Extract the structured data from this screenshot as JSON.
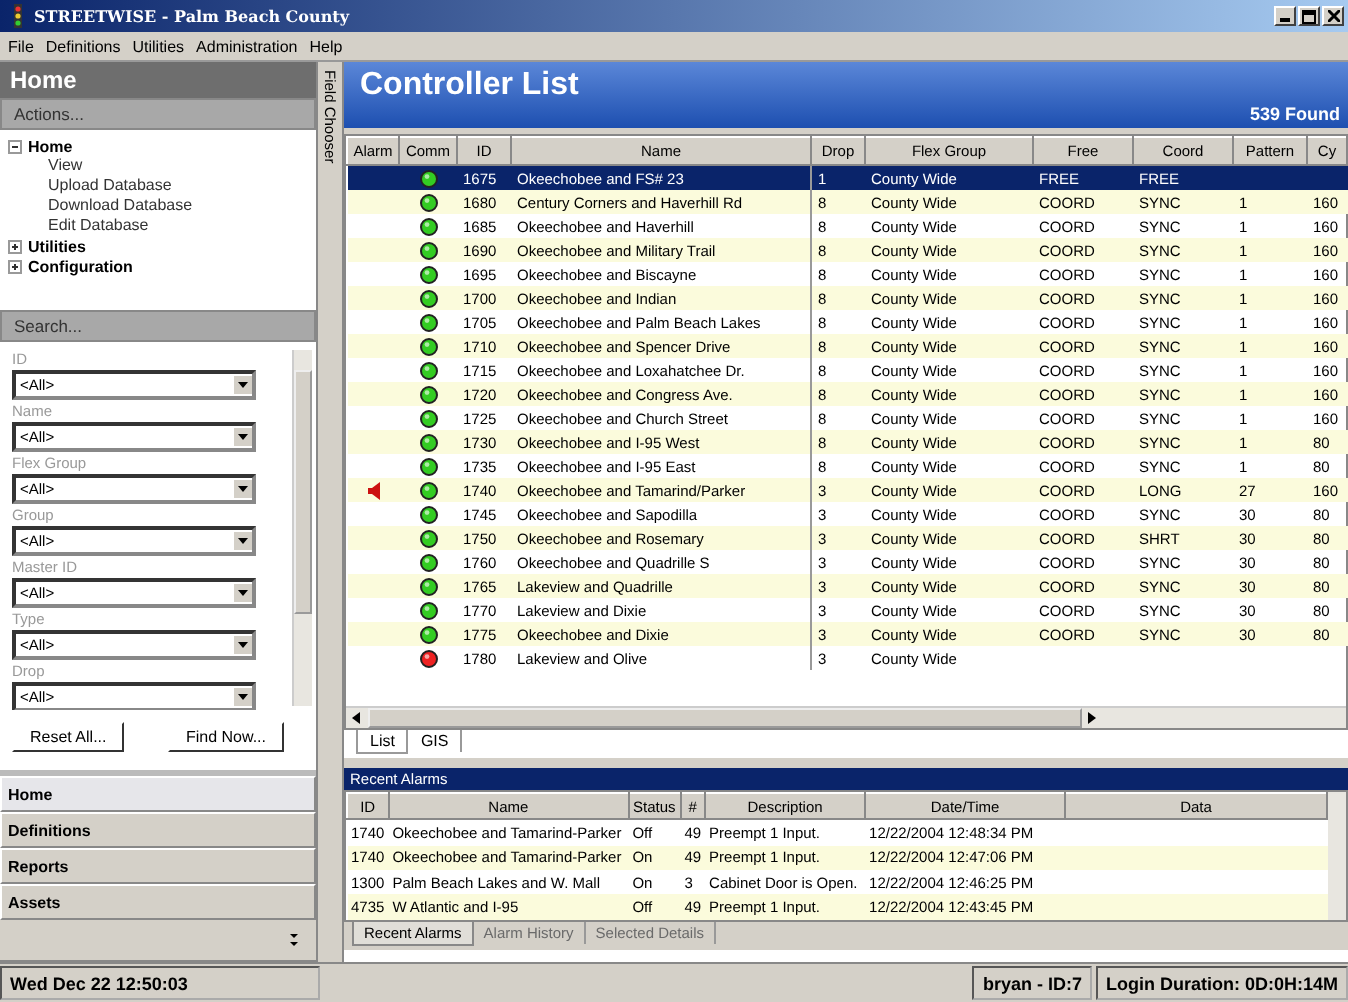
{
  "window": {
    "title": "STREETWISE - Palm Beach County"
  },
  "menu": [
    "File",
    "Definitions",
    "Utilities",
    "Administration",
    "Help"
  ],
  "sidebar": {
    "title": "Home",
    "actions_label": "Actions...",
    "tree": [
      {
        "label": "Home",
        "expanded": true,
        "children": [
          {
            "label": "View"
          },
          {
            "label": "Upload Database"
          },
          {
            "label": "Download Database"
          },
          {
            "label": "Edit Database"
          }
        ]
      },
      {
        "label": "Utilities",
        "expanded": false
      },
      {
        "label": "Configuration",
        "expanded": false
      }
    ],
    "search_label": "Search...",
    "fields": [
      {
        "label": "ID",
        "value": "<All>"
      },
      {
        "label": "Name",
        "value": "<All>"
      },
      {
        "label": "Flex Group",
        "value": "<All>"
      },
      {
        "label": "Group",
        "value": "<All>"
      },
      {
        "label": "Master ID",
        "value": "<All>"
      },
      {
        "label": "Type",
        "value": "<All>"
      },
      {
        "label": "Drop",
        "value": "<All>"
      }
    ],
    "buttons": [
      "Reset All...",
      "Find Now..."
    ],
    "nav": [
      {
        "label": "Home",
        "selected": true
      },
      {
        "label": "Definitions",
        "selected": false
      },
      {
        "label": "Reports",
        "selected": false
      },
      {
        "label": "Assets",
        "selected": false
      }
    ]
  },
  "field_chooser": "Field Chooser",
  "main": {
    "title": "Controller List",
    "count": "539 Found",
    "columns": [
      "Alarm",
      "Comm",
      "ID",
      "Name",
      "Drop",
      "Flex Group",
      "Free",
      "Coord",
      "Pattern",
      "Cy"
    ],
    "rows": [
      {
        "alarm": false,
        "comm_ok": true,
        "selected": true,
        "id": "1675",
        "name": "Okeechobee and FS# 23",
        "drop": "1",
        "flex_group": "County Wide",
        "free": "FREE",
        "coord": "FREE",
        "pattern": "",
        "column_10": ""
      },
      {
        "alarm": false,
        "comm_ok": true,
        "selected": false,
        "id": "1680",
        "name": "Century Corners and Haverhill Rd",
        "drop": "8",
        "flex_group": "County Wide",
        "free": "COORD",
        "coord": "SYNC",
        "pattern": "1",
        "column_10": "160"
      },
      {
        "alarm": false,
        "comm_ok": true,
        "selected": false,
        "id": "1685",
        "name": "Okeechobee and Haverhill",
        "drop": "8",
        "flex_group": "County Wide",
        "free": "COORD",
        "coord": "SYNC",
        "pattern": "1",
        "column_10": "160"
      },
      {
        "alarm": false,
        "comm_ok": true,
        "selected": false,
        "id": "1690",
        "name": "Okeechobee and Military Trail",
        "drop": "8",
        "flex_group": "County Wide",
        "free": "COORD",
        "coord": "SYNC",
        "pattern": "1",
        "column_10": "160"
      },
      {
        "alarm": false,
        "comm_ok": true,
        "selected": false,
        "id": "1695",
        "name": "Okeechobee and Biscayne",
        "drop": "8",
        "flex_group": "County Wide",
        "free": "COORD",
        "coord": "SYNC",
        "pattern": "1",
        "column_10": "160"
      },
      {
        "alarm": false,
        "comm_ok": true,
        "selected": false,
        "id": "1700",
        "name": "Okeechobee and Indian",
        "drop": "8",
        "flex_group": "County Wide",
        "free": "COORD",
        "coord": "SYNC",
        "pattern": "1",
        "column_10": "160"
      },
      {
        "alarm": false,
        "comm_ok": true,
        "selected": false,
        "id": "1705",
        "name": "Okeechobee and Palm Beach Lakes",
        "drop": "8",
        "flex_group": "County Wide",
        "free": "COORD",
        "coord": "SYNC",
        "pattern": "1",
        "column_10": "160"
      },
      {
        "alarm": false,
        "comm_ok": true,
        "selected": false,
        "id": "1710",
        "name": "Okeechobee and Spencer Drive",
        "drop": "8",
        "flex_group": "County Wide",
        "free": "COORD",
        "coord": "SYNC",
        "pattern": "1",
        "column_10": "160"
      },
      {
        "alarm": false,
        "comm_ok": true,
        "selected": false,
        "id": "1715",
        "name": "Okeechobee  and Loxahatchee Dr.",
        "drop": "8",
        "flex_group": "County Wide",
        "free": "COORD",
        "coord": "SYNC",
        "pattern": "1",
        "column_10": "160"
      },
      {
        "alarm": false,
        "comm_ok": true,
        "selected": false,
        "id": "1720",
        "name": "Okeechobee  and Congress Ave.",
        "drop": "8",
        "flex_group": "County Wide",
        "free": "COORD",
        "coord": "SYNC",
        "pattern": "1",
        "column_10": "160"
      },
      {
        "alarm": false,
        "comm_ok": true,
        "selected": false,
        "id": "1725",
        "name": "Okeechobee  and Church Street",
        "drop": "8",
        "flex_group": "County Wide",
        "free": "COORD",
        "coord": "SYNC",
        "pattern": "1",
        "column_10": "160"
      },
      {
        "alarm": false,
        "comm_ok": true,
        "selected": false,
        "id": "1730",
        "name": "Okeechobee and I-95 West",
        "drop": "8",
        "flex_group": "County Wide",
        "free": "COORD",
        "coord": "SYNC",
        "pattern": "1",
        "column_10": "80"
      },
      {
        "alarm": false,
        "comm_ok": true,
        "selected": false,
        "id": "1735",
        "name": "Okeechobee and I-95 East",
        "drop": "8",
        "flex_group": "County Wide",
        "free": "COORD",
        "coord": "SYNC",
        "pattern": "1",
        "column_10": "80"
      },
      {
        "alarm": true,
        "comm_ok": true,
        "selected": false,
        "id": "1740",
        "name": "Okeechobee and Tamarind/Parker",
        "drop": "3",
        "flex_group": "County Wide",
        "free": "COORD",
        "coord": "LONG",
        "pattern": "27",
        "column_10": "160"
      },
      {
        "alarm": false,
        "comm_ok": true,
        "selected": false,
        "id": "1745",
        "name": "Okeechobee and Sapodilla",
        "drop": "3",
        "flex_group": "County Wide",
        "free": "COORD",
        "coord": "SYNC",
        "pattern": "30",
        "column_10": "80"
      },
      {
        "alarm": false,
        "comm_ok": true,
        "selected": false,
        "id": "1750",
        "name": "Okeechobee and Rosemary",
        "drop": "3",
        "flex_group": "County Wide",
        "free": "COORD",
        "coord": "SHRT",
        "pattern": "30",
        "column_10": "80"
      },
      {
        "alarm": false,
        "comm_ok": true,
        "selected": false,
        "id": "1760",
        "name": "Okeechobee and Quadrille S",
        "drop": "3",
        "flex_group": "County Wide",
        "free": "COORD",
        "coord": "SYNC",
        "pattern": "30",
        "column_10": "80"
      },
      {
        "alarm": false,
        "comm_ok": true,
        "selected": false,
        "id": "1765",
        "name": "Lakeview and Quadrille",
        "drop": "3",
        "flex_group": "County Wide",
        "free": "COORD",
        "coord": "SYNC",
        "pattern": "30",
        "column_10": "80"
      },
      {
        "alarm": false,
        "comm_ok": true,
        "selected": false,
        "id": "1770",
        "name": "Lakeview and Dixie",
        "drop": "3",
        "flex_group": "County Wide",
        "free": "COORD",
        "coord": "SYNC",
        "pattern": "30",
        "column_10": "80"
      },
      {
        "alarm": false,
        "comm_ok": true,
        "selected": false,
        "id": "1775",
        "name": "Okeechobee and Dixie",
        "drop": "3",
        "flex_group": "County Wide",
        "free": "COORD",
        "coord": "SYNC",
        "pattern": "30",
        "column_10": "80"
      },
      {
        "alarm": false,
        "comm_ok": false,
        "selected": false,
        "id": "1780",
        "name": "Lakeview and Olive",
        "drop": "3",
        "flex_group": "County Wide",
        "free": "",
        "coord": "",
        "pattern": "",
        "column_10": ""
      }
    ],
    "view_tabs": [
      {
        "label": "List",
        "selected": true
      },
      {
        "label": "GIS",
        "selected": false
      }
    ]
  },
  "alarms": {
    "title": "Recent Alarms",
    "columns": [
      "ID",
      "Name",
      "Status",
      "#",
      "Description",
      "Date/Time",
      "Data"
    ],
    "rows": [
      {
        "id": "1740",
        "name": "Okeechobee and Tamarind-Parker",
        "status": "Off",
        "num": "49",
        "description": "Preempt 1 Input.",
        "datetime": "12/22/2004 12:48:34 PM"
      },
      {
        "id": "1740",
        "name": "Okeechobee and Tamarind-Parker",
        "status": "On",
        "num": "49",
        "description": "Preempt 1 Input.",
        "datetime": "12/22/2004 12:47:06 PM"
      },
      {
        "id": "1300",
        "name": "Palm Beach Lakes and W. Mall",
        "status": "On",
        "num": "3",
        "description": "Cabinet Door is Open.",
        "datetime": "12/22/2004 12:46:25 PM"
      },
      {
        "id": "4735",
        "name": "W Atlantic and I-95",
        "status": "Off",
        "num": "49",
        "description": "Preempt 1 Input.",
        "datetime": "12/22/2004 12:43:45 PM"
      }
    ],
    "tabs": [
      {
        "label": "Recent Alarms",
        "selected": true
      },
      {
        "label": "Alarm History",
        "selected": false
      },
      {
        "label": "Selected Details",
        "selected": false
      }
    ]
  },
  "status_bar": {
    "clock": "Wed Dec 22 12:50:03",
    "user": "bryan - ID:7",
    "login": "Login Duration: 0D:0H:14M"
  }
}
